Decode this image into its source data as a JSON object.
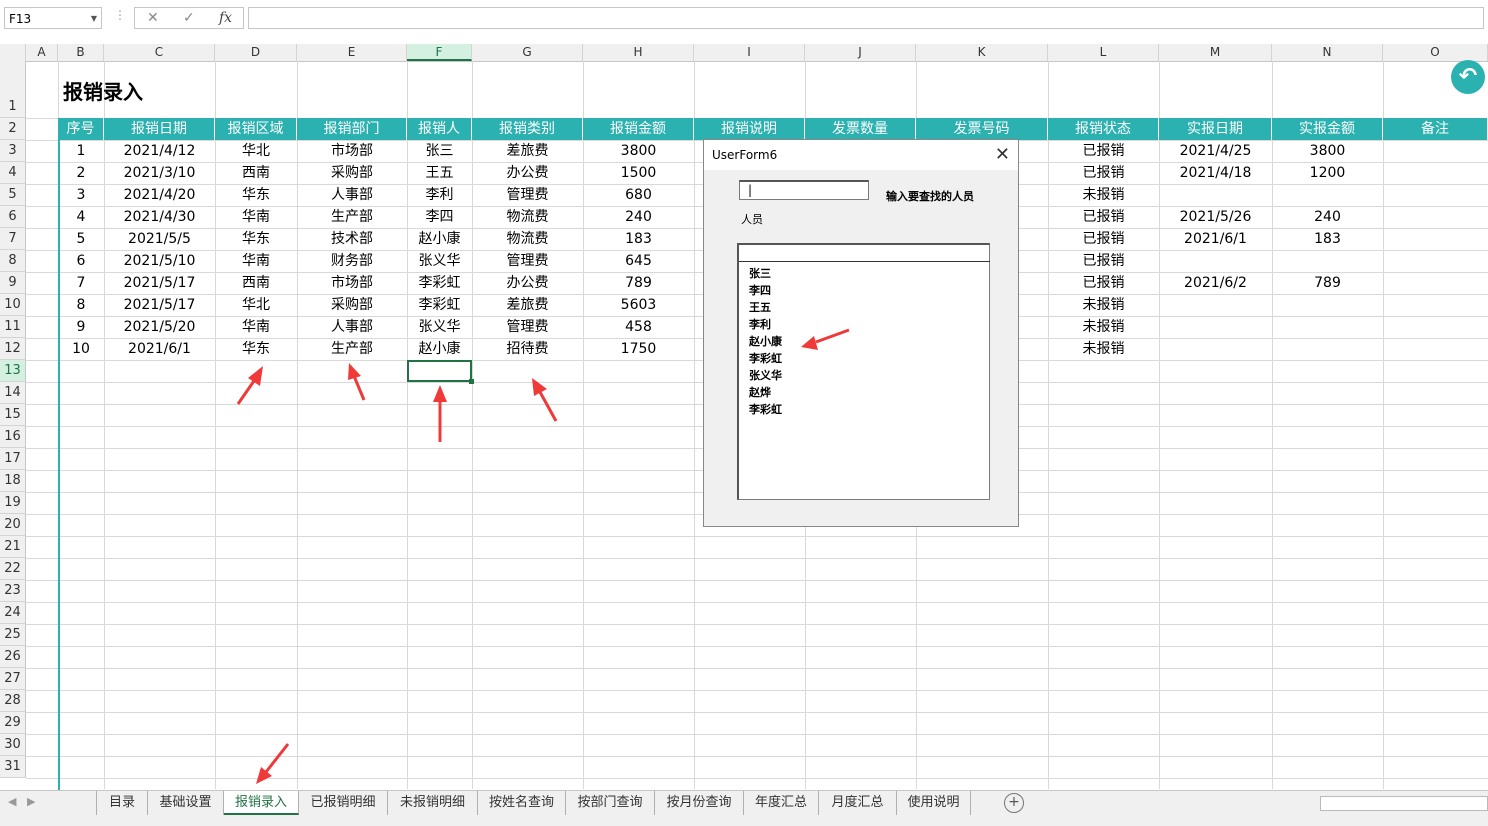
{
  "formula_bar": {
    "name_box": "F13",
    "cancel": "✕",
    "enter": "✓",
    "fx": "fx",
    "value": ""
  },
  "columns": [
    "A",
    "B",
    "C",
    "D",
    "E",
    "F",
    "G",
    "H",
    "I",
    "J",
    "K",
    "L",
    "M",
    "N",
    "O"
  ],
  "rows": [
    "1",
    "2",
    "3",
    "4",
    "5",
    "6",
    "7",
    "8",
    "9",
    "10",
    "11",
    "12",
    "13",
    "14",
    "15",
    "16",
    "17",
    "18",
    "19",
    "20",
    "21",
    "22",
    "23",
    "24",
    "25",
    "26",
    "27",
    "28",
    "29",
    "30",
    "31"
  ],
  "sheet": {
    "title": "报销录入",
    "headers": [
      "序号",
      "报销日期",
      "报销区域",
      "报销部门",
      "报销人",
      "报销类别",
      "报销金额",
      "报销说明",
      "发票数量",
      "发票号码",
      "报销状态",
      "实报日期",
      "实报金额",
      "备注"
    ],
    "left_rows": [
      [
        "1",
        "2021/4/12",
        "华北",
        "市场部",
        "张三",
        "差旅费",
        "3800"
      ],
      [
        "2",
        "2021/3/10",
        "西南",
        "采购部",
        "王五",
        "办公费",
        "1500"
      ],
      [
        "3",
        "2021/4/20",
        "华东",
        "人事部",
        "李利",
        "管理费",
        "680"
      ],
      [
        "4",
        "2021/4/30",
        "华南",
        "生产部",
        "李四",
        "物流费",
        "240"
      ],
      [
        "5",
        "2021/5/5",
        "华东",
        "技术部",
        "赵小康",
        "物流费",
        "183"
      ],
      [
        "6",
        "2021/5/10",
        "华南",
        "财务部",
        "张义华",
        "管理费",
        "645"
      ],
      [
        "7",
        "2021/5/17",
        "西南",
        "市场部",
        "李彩虹",
        "办公费",
        "789"
      ],
      [
        "8",
        "2021/5/17",
        "华北",
        "采购部",
        "李彩虹",
        "差旅费",
        "5603"
      ],
      [
        "9",
        "2021/5/20",
        "华南",
        "人事部",
        "张义华",
        "管理费",
        "458"
      ],
      [
        "10",
        "2021/6/1",
        "华东",
        "生产部",
        "赵小康",
        "招待费",
        "1750"
      ]
    ],
    "right_rows": [
      [
        "已报销",
        "2021/4/25",
        "3800"
      ],
      [
        "已报销",
        "2021/4/18",
        "1200"
      ],
      [
        "未报销",
        "",
        ""
      ],
      [
        "已报销",
        "2021/5/26",
        "240"
      ],
      [
        "已报销",
        "2021/6/1",
        "183"
      ],
      [
        "已报销",
        "",
        ""
      ],
      [
        "已报销",
        "2021/6/2",
        "789"
      ],
      [
        "未报销",
        "",
        ""
      ],
      [
        "未报销",
        "",
        ""
      ],
      [
        "未报销",
        "",
        ""
      ]
    ]
  },
  "userform": {
    "title": "UserForm6",
    "input_value": "|",
    "label_find": "输入要查找的人员",
    "label_person": "人员",
    "list_items": [
      "张三",
      "李四",
      "王五",
      "李利",
      "赵小康",
      "李彩虹",
      "张义华",
      "赵烨",
      "李彩虹"
    ]
  },
  "tabs": [
    "目录",
    "基础设置",
    "报销录入",
    "已报销明细",
    "未报销明细",
    "按姓名查询",
    "按部门查询",
    "按月份查询",
    "年度汇总",
    "月度汇总",
    "使用说明"
  ],
  "active_tab": "报销录入",
  "colors": {
    "teal": "#2cb1b1",
    "excel_green": "#217346",
    "arrow_red": "#f03a3a"
  }
}
